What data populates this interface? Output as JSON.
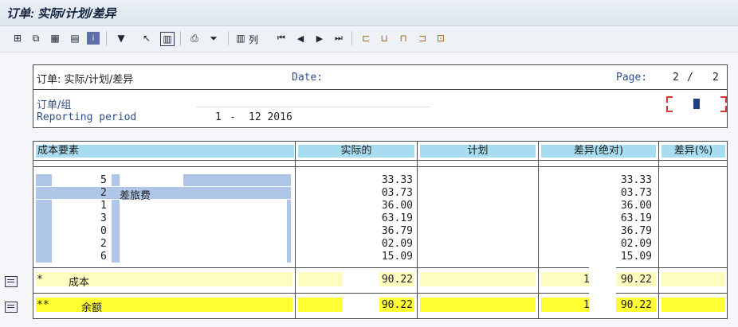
{
  "window": {
    "title": "订单: 实际/计划/差异"
  },
  "toolbar": {
    "icons": [
      "tree-icon",
      "column-select-icon",
      "layout-icon",
      "grid-icon",
      "info-icon",
      "filter-icon",
      "select-icon",
      "table-config-icon",
      "print-icon",
      "filter-funnel-icon",
      "columns-icon",
      "first-page-icon",
      "previous-page-icon",
      "next-page-icon",
      "last-page-icon",
      "hierarchy-icon-1",
      "hierarchy-icon-2",
      "hierarchy-icon-3",
      "hierarchy-icon-4",
      "hierarchy-icon-5"
    ],
    "columns_label": "列"
  },
  "report": {
    "header_title": "订单: 实际/计划/差异",
    "date_label": "Date:",
    "page_label": "Page:",
    "page_current": "2",
    "page_separator": "/",
    "page_total": "2",
    "order_group_label": "订单/组",
    "reporting_period_label": "Reporting period",
    "period_from": "1",
    "period_dash": "-",
    "period_to": "12 2016"
  },
  "table": {
    "columns": [
      "成本要素",
      "实际的",
      "计划",
      "差异(绝对)",
      "差异(%)"
    ],
    "rows": [
      {
        "code": "5",
        "desc": "",
        "actual": "33.33",
        "variance": "33.33"
      },
      {
        "code": "2",
        "desc": "差旅费",
        "actual": "03.73",
        "variance": "03.73"
      },
      {
        "code": "1",
        "desc": "",
        "actual": "36.00",
        "variance": "36.00"
      },
      {
        "code": "3",
        "desc": "",
        "actual": "63.19",
        "variance": "63.19"
      },
      {
        "code": "0",
        "desc": "",
        "actual": "36.79",
        "variance": "36.79"
      },
      {
        "code": "2",
        "desc": "",
        "actual": "02.09",
        "variance": "02.09"
      },
      {
        "code": "6",
        "desc": "",
        "actual": "15.09",
        "variance": "15.09"
      }
    ],
    "subtotal": {
      "marker": "*",
      "label": "成本",
      "actual": "90.22",
      "variance_prefix": "1",
      "variance": "90.22"
    },
    "total": {
      "marker": "**",
      "label": "余额",
      "actual": "90.22",
      "variance_prefix": "1",
      "variance": "90.22"
    }
  },
  "colors": {
    "header_blue": "#a8dcf0",
    "row_select_blue": "#b0c6e8",
    "subtotal_yellow": "#fffcc0",
    "total_yellow": "#ffff33"
  }
}
